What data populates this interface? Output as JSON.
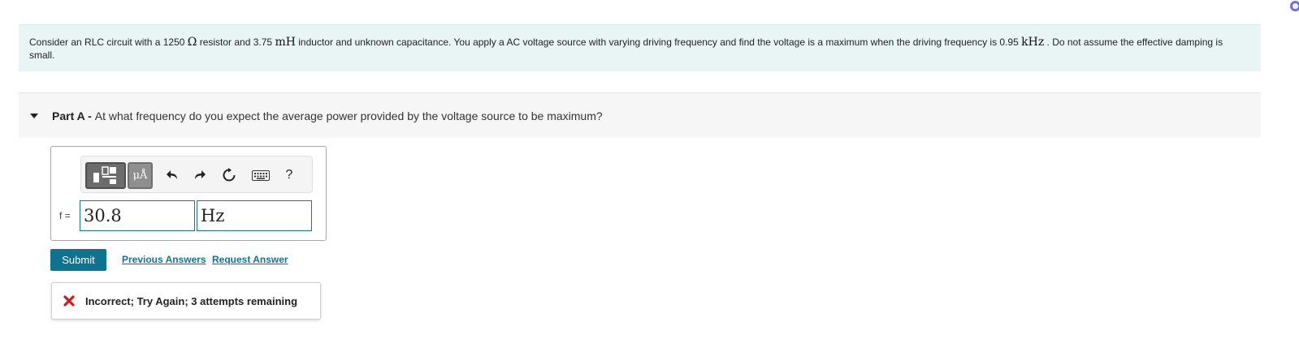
{
  "problem": {
    "t1": "Consider an RLC circuit with a 1250 ",
    "ohm": "Ω",
    "t2": " resistor and 3.75 ",
    "mh": "mH",
    "t3": " inductor and unknown capacitance. You apply a AC voltage source with varying driving frequency and find the voltage is a maximum when the driving frequency is 0.95 ",
    "khz": "kHz",
    "t4": " . Do not assume the effective damping is small."
  },
  "part_a": {
    "label": "Part A -",
    "question": "At what frequency do you expect the average power provided by the voltage source to be maximum?"
  },
  "toolbar": {
    "units_label": "μÅ",
    "help_label": "?"
  },
  "answer": {
    "variable_label": "f =",
    "value": "30.8",
    "units": "Hz"
  },
  "actions": {
    "submit_label": "Submit",
    "previous_answers": "Previous Answers",
    "request_answer": "Request Answer"
  },
  "feedback": {
    "message": "Incorrect; Try Again; 3 attempts remaining"
  },
  "colors": {
    "accent": "#0d7490",
    "problem_bg": "#e8f5f4",
    "error": "#d01c1c"
  }
}
